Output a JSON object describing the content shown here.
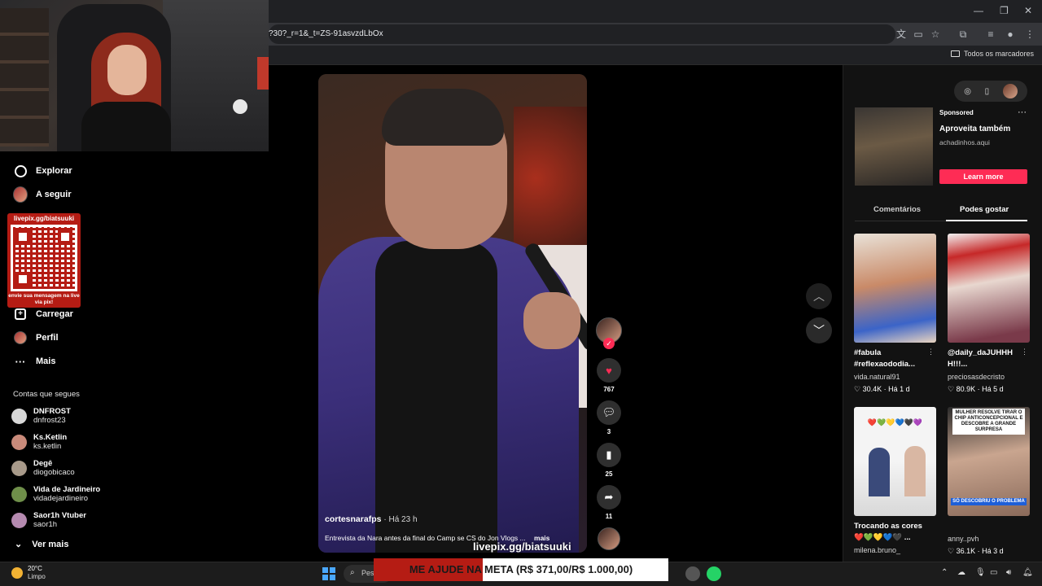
{
  "browser": {
    "url": "?30?_r=1&_t=ZS-91asvzdLbOx",
    "bookmarks_label": "Todos os marcadores"
  },
  "nav": {
    "items": [
      {
        "label": "Explorar",
        "icon": "compass-icon"
      },
      {
        "label": "A seguir",
        "icon": "avatar-icon"
      },
      {
        "label": "Carregar",
        "icon": "upload-icon"
      },
      {
        "label": "Perfil",
        "icon": "avatar-icon"
      },
      {
        "label": "Mais",
        "icon": "more-icon"
      }
    ],
    "following_title": "Contas que segues",
    "following": [
      {
        "name": "DNFROST",
        "user": "dnfrost23",
        "color": "#d8d8d8"
      },
      {
        "name": "Ks.Ketlin",
        "user": "ks.ketlin",
        "color": "#c98a7a"
      },
      {
        "name": "Degê",
        "user": "diogobicaco",
        "color": "#a89a8a"
      },
      {
        "name": "Vida de Jardineiro",
        "user": "vidadejardineiro",
        "color": "#6f8f4a"
      },
      {
        "name": "Saor1h Vtuber",
        "user": "saor1h",
        "color": "#b58ab0"
      }
    ],
    "see_more": "Ver mais"
  },
  "qr_card": {
    "title": "livepix.gg/biatsuuki",
    "subtitle": "envie sua mensagem na live via pix!"
  },
  "video": {
    "author": "cortesnarafps",
    "time": "· Há 23 h",
    "description": "Entrevista da Nara antes da final do Camp se CS do Jon Vlogs ...",
    "more": "mais",
    "likes": "767",
    "comments": "3",
    "saves": "25",
    "shares": "11"
  },
  "ad": {
    "sponsored": "Sponsored",
    "title": "Aproveita também",
    "advertiser": "achadinhos.aqui",
    "cta": "Learn more"
  },
  "tabs": {
    "comments": "Comentários",
    "may_like": "Podes gostar"
  },
  "recommendations": [
    {
      "title": "#fabula #reflexaododia...",
      "user": "vida.natural91",
      "views": "30.4K",
      "time": "Há 1 d"
    },
    {
      "title": "@daily_daJUHHH H!!!...",
      "user": "preciosasdecristo",
      "views": "80.9K",
      "time": "Há 5 d"
    },
    {
      "title": "Trocando as cores",
      "title2": "❤️💚💛💙🖤 ...",
      "user": "milena.bruno_",
      "views": "",
      "time": ""
    },
    {
      "title": "",
      "user": "anny..pvh",
      "views": "36.1K",
      "time": "Há 3 d"
    }
  ],
  "thumb_texts": {
    "card4_overlay": "MULHER RESOLVE TIRAR O CHIP ANTICONCEPCIONAL E DESCOBRE A GRANDE SURPRESA",
    "card4_banner": "SÓ DESCOBRIU O PROBLEMA",
    "card3_hearts": "❤️💚💛💙🖤💜"
  },
  "stream_overlay": {
    "livepix_url": "livepix.gg/biatsuuki",
    "goal_text": "ME AJUDE NA META (R$ 371,00/R$ 1.000,00)",
    "goal_progress": 0.371
  },
  "taskbar": {
    "temp": "20°C",
    "condition": "Limpo",
    "search_placeholder": "Pes"
  },
  "colors": {
    "accent": "#fe2c55",
    "livepix_red": "#b51c14"
  }
}
